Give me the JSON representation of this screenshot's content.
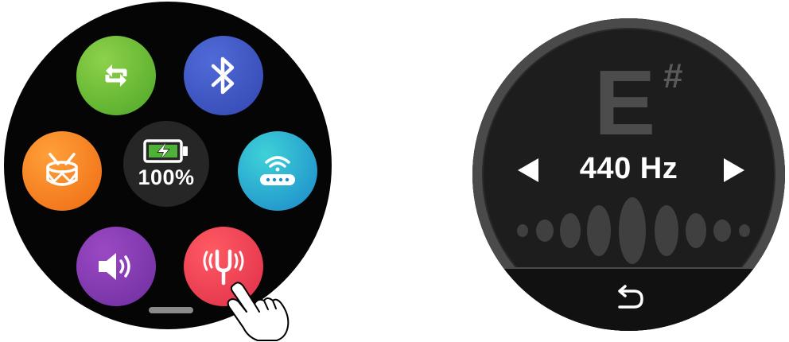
{
  "launcher": {
    "apps": [
      {
        "id": "sync",
        "icon": "sync-icon",
        "color": "#5cb32e"
      },
      {
        "id": "bluetooth",
        "icon": "bluetooth-icon",
        "color": "#3f57c4"
      },
      {
        "id": "metronome",
        "icon": "drum-icon",
        "color": "#f47d20"
      },
      {
        "id": "router",
        "icon": "router-icon",
        "color": "#26aed0"
      },
      {
        "id": "volume",
        "icon": "speaker-icon",
        "color": "#7e38ae"
      },
      {
        "id": "tuner",
        "icon": "tuning-fork-icon",
        "color": "#e83a52"
      }
    ],
    "battery": {
      "icon": "battery-charging-icon",
      "percent_text": "100%",
      "level": 1.0
    }
  },
  "tuner": {
    "note": "E",
    "accidental": "#",
    "frequency": "440 Hz",
    "prev_icon": "triangle-left-icon",
    "next_icon": "triangle-right-icon",
    "back_icon": "back-arrow-icon"
  }
}
